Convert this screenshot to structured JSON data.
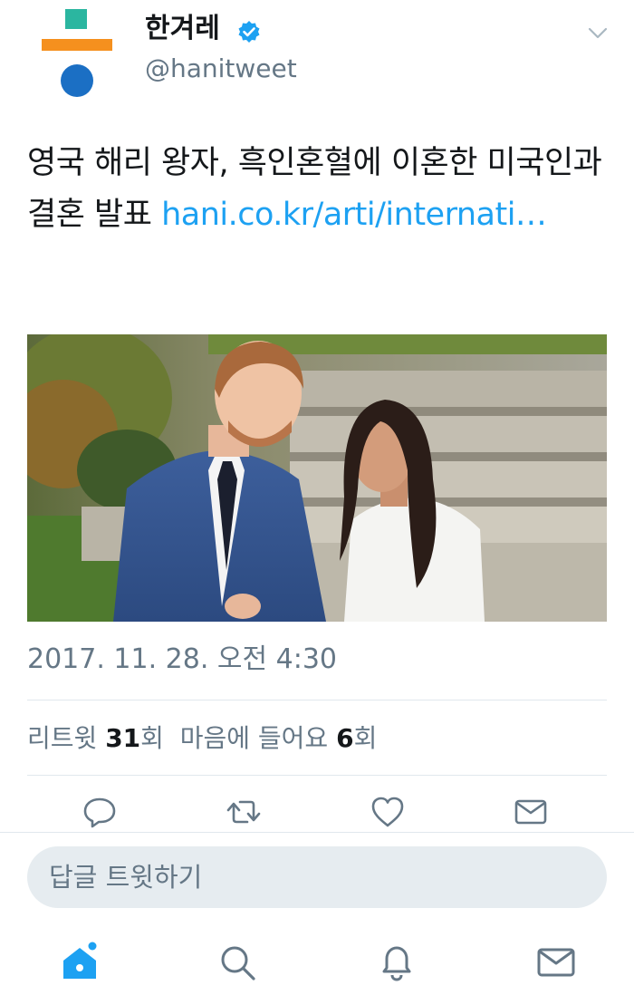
{
  "account": {
    "display_name": "한겨레",
    "handle": "@hanitweet",
    "verified": true,
    "logo_colors": [
      "#2bb6a0",
      "#f5901e",
      "#1b6fc4"
    ]
  },
  "tweet": {
    "text_main": "영국 해리 왕자, 흑인혼혈에 이혼한 미국인과 결혼 발표 ",
    "link_text": "hani.co.kr/arti/internati…",
    "timestamp": "2017. 11. 28. 오전 4:30",
    "photo_icon": "photo-image"
  },
  "stats": {
    "retweets_label": "리트윗",
    "retweets_count": "31",
    "retweets_suffix": "회",
    "likes_label": "마음에 들어요",
    "likes_count": "6",
    "likes_suffix": "회"
  },
  "actions": {
    "reply_icon": "reply-icon",
    "retweet_icon": "retweet-icon",
    "like_icon": "heart-icon",
    "dm_icon": "mail-icon"
  },
  "reply_box": {
    "placeholder": "답글 트윗하기"
  },
  "bottom_nav": {
    "items": [
      "home-icon",
      "search-icon",
      "notifications-icon",
      "messages-icon"
    ],
    "active": "home-icon",
    "accent": "#1da1f2"
  }
}
